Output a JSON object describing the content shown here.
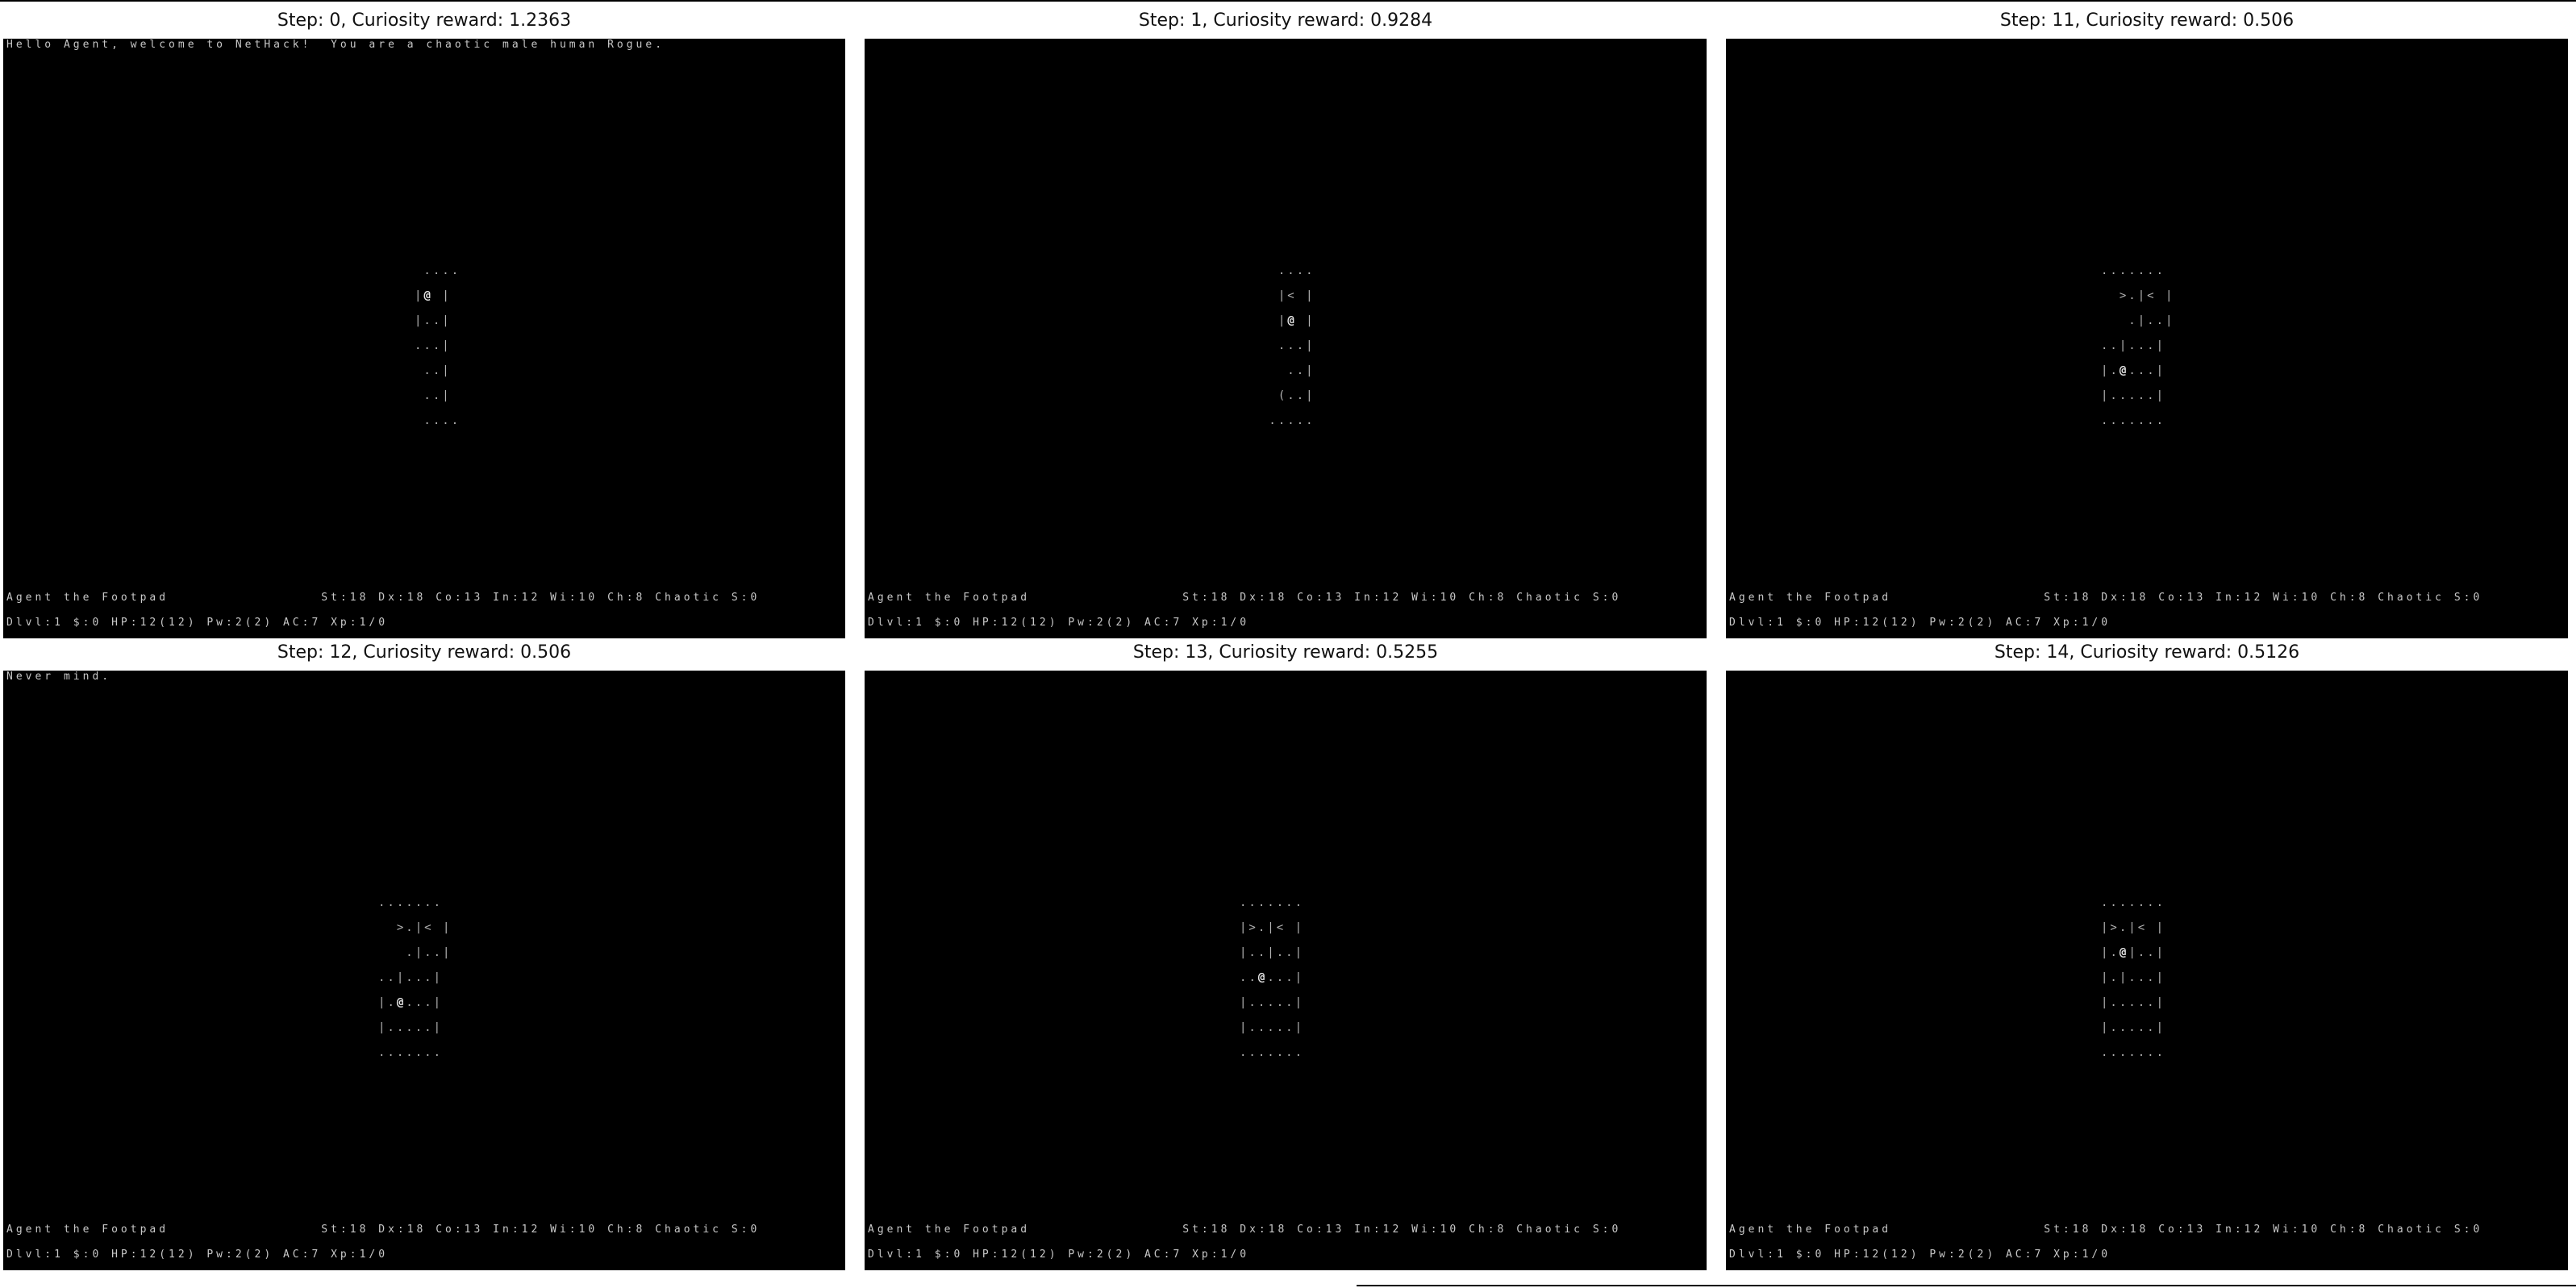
{
  "panels": [
    {
      "title": "Step: 0, Curiosity reward: 1.2363",
      "message": "Hello Agent, welcome to NetHack!  You are a chaotic male human Rogue.",
      "status_line_1": "Agent the Footpad                St:18 Dx:18 Co:13 In:12 Wi:10 Ch:8 Chaotic S:0",
      "status_line_2": "Dlvl:1 $:0 HP:12(12) Pw:2(2) AC:7 Xp:1/0",
      "map": [
        " ....",
        "|@ |",
        "|..|",
        "...|",
        " ..|",
        " ..|",
        " ...."
      ]
    },
    {
      "title": "Step: 1, Curiosity reward: 0.9284",
      "message": "",
      "status_line_1": "Agent the Footpad                St:18 Dx:18 Co:13 In:12 Wi:10 Ch:8 Chaotic S:0",
      "status_line_2": "Dlvl:1 $:0 HP:12(12) Pw:2(2) AC:7 Xp:1/0",
      "map": [
        "  ....",
        "  |< |",
        "  |@ |",
        "  ...|",
        "   ..|",
        "  (..|",
        " ....."
      ]
    },
    {
      "title": "Step: 11, Curiosity reward: 0.506",
      "message": "",
      "status_line_1": "Agent the Footpad                St:18 Dx:18 Co:13 In:12 Wi:10 Ch:8 Chaotic S:0",
      "status_line_2": "Dlvl:1 $:0 HP:12(12) Pw:2(2) AC:7 Xp:1/0",
      "map": [
        ".......",
        "  >.|< |",
        "   .|..|",
        "..|...|",
        "|.@...|",
        "|.....|",
        "......."
      ]
    },
    {
      "title": "Step: 12, Curiosity reward: 0.506",
      "message": "Never mind.",
      "status_line_1": "Agent the Footpad                St:18 Dx:18 Co:13 In:12 Wi:10 Ch:8 Chaotic S:0",
      "status_line_2": "Dlvl:1 $:0 HP:12(12) Pw:2(2) AC:7 Xp:1/0",
      "map": [
        ".......",
        "  >.|< |",
        "   .|..|",
        "..|...|",
        "|.@...|",
        "|.....|",
        "......."
      ]
    },
    {
      "title": "Step: 13, Curiosity reward: 0.5255",
      "message": "",
      "status_line_1": "Agent the Footpad                St:18 Dx:18 Co:13 In:12 Wi:10 Ch:8 Chaotic S:0",
      "status_line_2": "Dlvl:1 $:0 HP:12(12) Pw:2(2) AC:7 Xp:1/0",
      "map": [
        ".......",
        "|>.|< |",
        "|..|..|",
        "..@...|",
        "|.....|",
        "|.....|",
        "......."
      ]
    },
    {
      "title": "Step: 14, Curiosity reward: 0.5126",
      "message": "",
      "status_line_1": "Agent the Footpad                St:18 Dx:18 Co:13 In:12 Wi:10 Ch:8 Chaotic S:0",
      "status_line_2": "Dlvl:1 $:0 HP:12(12) Pw:2(2) AC:7 Xp:1/0",
      "map": [
        ".......",
        "|>.|< |",
        "|.@|..|",
        "|.|...|",
        "|.....|",
        "|.....|",
        "......."
      ]
    }
  ],
  "colors": {
    "screen_background": "#000000",
    "text": "#c8c8c8",
    "agent": "#e6e6e6",
    "door": "#b5a33a"
  }
}
